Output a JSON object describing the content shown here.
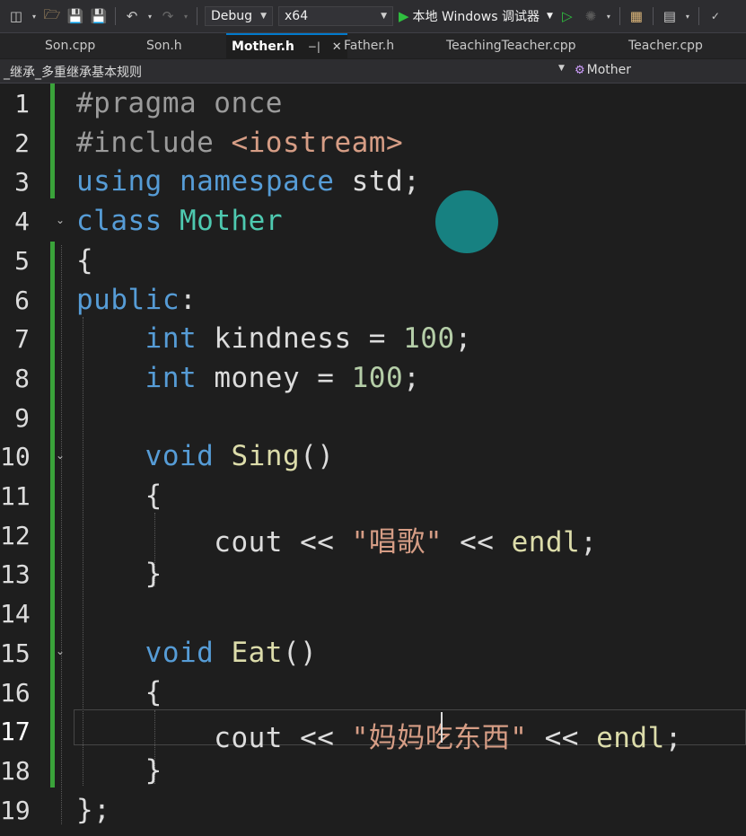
{
  "toolbar": {
    "config": "Debug",
    "platform": "x64",
    "run_label": "本地 Windows 调试器"
  },
  "tabs": [
    {
      "label": "Son.cpp"
    },
    {
      "label": "Son.h"
    },
    {
      "label": "Mother.h",
      "active": true
    },
    {
      "label": "Father.h"
    },
    {
      "label": "TeachingTeacher.cpp"
    },
    {
      "label": "Teacher.cpp"
    }
  ],
  "navbar": {
    "project": "_继承_多重继承基本规则",
    "class_name": "Mother"
  },
  "editor": {
    "current_line": 17,
    "lines": [
      {
        "n": "1",
        "seg": [
          {
            "t": "#pragma once",
            "c": "pp"
          }
        ]
      },
      {
        "n": "2",
        "seg": [
          {
            "t": "#include ",
            "c": "pp"
          },
          {
            "t": "<iostream>",
            "c": "inc"
          }
        ]
      },
      {
        "n": "3",
        "seg": [
          {
            "t": "using",
            "c": "kw"
          },
          {
            "t": " ",
            "c": ""
          },
          {
            "t": "namespace",
            "c": "kw"
          },
          {
            "t": " std;",
            "c": ""
          }
        ]
      },
      {
        "n": "4",
        "seg": [
          {
            "t": "class",
            "c": "kw"
          },
          {
            "t": " ",
            "c": ""
          },
          {
            "t": "Mother",
            "c": "cls-name"
          }
        ]
      },
      {
        "n": "5",
        "seg": [
          {
            "t": "{",
            "c": ""
          }
        ]
      },
      {
        "n": "6",
        "seg": [
          {
            "t": "public",
            "c": "kw"
          },
          {
            "t": ":",
            "c": ""
          }
        ]
      },
      {
        "n": "7",
        "seg": [
          {
            "t": "    ",
            "c": ""
          },
          {
            "t": "int",
            "c": "kw"
          },
          {
            "t": " kindness = ",
            "c": ""
          },
          {
            "t": "100",
            "c": "num"
          },
          {
            "t": ";",
            "c": ""
          }
        ]
      },
      {
        "n": "8",
        "seg": [
          {
            "t": "    ",
            "c": ""
          },
          {
            "t": "int",
            "c": "kw"
          },
          {
            "t": " money = ",
            "c": ""
          },
          {
            "t": "100",
            "c": "num"
          },
          {
            "t": ";",
            "c": ""
          }
        ]
      },
      {
        "n": "9",
        "seg": []
      },
      {
        "n": "10",
        "seg": [
          {
            "t": "    ",
            "c": ""
          },
          {
            "t": "void",
            "c": "kw"
          },
          {
            "t": " ",
            "c": ""
          },
          {
            "t": "Sing",
            "c": "fn"
          },
          {
            "t": "()",
            "c": ""
          }
        ]
      },
      {
        "n": "11",
        "seg": [
          {
            "t": "    {",
            "c": ""
          }
        ]
      },
      {
        "n": "12",
        "seg": [
          {
            "t": "        cout << ",
            "c": ""
          },
          {
            "t": "\"唱歌\"",
            "c": "str"
          },
          {
            "t": " << ",
            "c": ""
          },
          {
            "t": "endl",
            "c": "fn"
          },
          {
            "t": ";",
            "c": ""
          }
        ]
      },
      {
        "n": "13",
        "seg": [
          {
            "t": "    }",
            "c": ""
          }
        ]
      },
      {
        "n": "14",
        "seg": []
      },
      {
        "n": "15",
        "seg": [
          {
            "t": "    ",
            "c": ""
          },
          {
            "t": "void",
            "c": "kw"
          },
          {
            "t": " ",
            "c": ""
          },
          {
            "t": "Eat",
            "c": "fn"
          },
          {
            "t": "()",
            "c": ""
          }
        ]
      },
      {
        "n": "16",
        "seg": [
          {
            "t": "    {",
            "c": ""
          }
        ]
      },
      {
        "n": "17",
        "seg": [
          {
            "t": "        cout << ",
            "c": ""
          },
          {
            "t": "\"妈妈吃东西\"",
            "c": "str"
          },
          {
            "t": " << ",
            "c": ""
          },
          {
            "t": "endl",
            "c": "fn"
          },
          {
            "t": ";",
            "c": ""
          }
        ]
      },
      {
        "n": "18",
        "seg": [
          {
            "t": "    }",
            "c": ""
          }
        ]
      },
      {
        "n": "19",
        "seg": [
          {
            "t": "};",
            "c": ""
          }
        ]
      }
    ]
  }
}
